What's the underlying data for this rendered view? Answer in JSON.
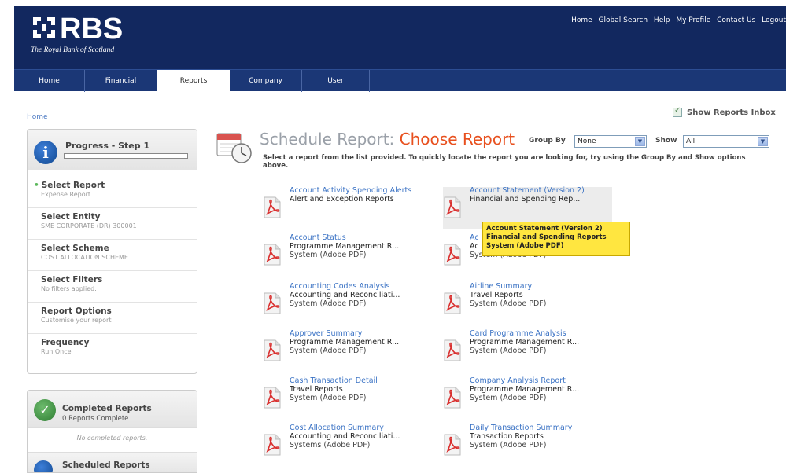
{
  "brand": {
    "name": "RBS",
    "tagline": "The Royal Bank of Scotland"
  },
  "toplinks": [
    "Home",
    "Global Search",
    "Help",
    "My Profile",
    "Contact Us",
    "Logout"
  ],
  "tabs": [
    "Home",
    "Financial",
    "Reports",
    "Company",
    "User"
  ],
  "active_tab": "Reports",
  "breadcrumb": "Home",
  "inbox": {
    "label": "Show Reports Inbox",
    "checked": true
  },
  "progress": {
    "title": "Progress - Step 1",
    "value": 0,
    "steps": [
      {
        "title": "Select Report",
        "sub": "Expense Report"
      },
      {
        "title": "Select Entity",
        "sub": "SME CORPORATE (DR) 300001"
      },
      {
        "title": "Select Scheme",
        "sub": "COST ALLOCATION SCHEME"
      },
      {
        "title": "Select Filters",
        "sub": "No filters applied."
      },
      {
        "title": "Report Options",
        "sub": "Customise your report"
      },
      {
        "title": "Frequency",
        "sub": "Run Once"
      }
    ]
  },
  "completed": {
    "title": "Completed Reports",
    "count": "0 Reports Complete",
    "empty": "No completed reports."
  },
  "scheduled": {
    "title": "Scheduled Reports"
  },
  "main": {
    "title_prefix": "Schedule Report: ",
    "title_accent": "Choose Report",
    "group_by_label": "Group By",
    "group_by_value": "None",
    "show_label": "Show",
    "show_value": "All",
    "instructions": "Select a report from the list provided. To quickly locate the report you are looking for, try using the Group By and Show options above."
  },
  "reports": [
    {
      "name": "Account Activity Spending Alerts",
      "category": "Alert and Exception Reports",
      "system": ""
    },
    {
      "name": "Account Statement (Version 2)",
      "category": "Financial and Spending Rep...",
      "system": ""
    },
    {
      "name": "Account Status",
      "category": "Programme Management R...",
      "system": "System (Adobe PDF)"
    },
    {
      "name": "Ac",
      "category": "Ac",
      "system": "System (Adobe PDF)"
    },
    {
      "name": "Accounting Codes Analysis",
      "category": "Accounting and Reconciliati...",
      "system": "System (Adobe PDF)"
    },
    {
      "name": "Airline Summary",
      "category": "Travel Reports",
      "system": "System (Adobe PDF)"
    },
    {
      "name": "Approver Summary",
      "category": "Programme Management R...",
      "system": "System (Adobe PDF)"
    },
    {
      "name": "Card Programme Analysis",
      "category": "Programme Management R...",
      "system": "System (Adobe PDF)"
    },
    {
      "name": "Cash Transaction Detail",
      "category": "Travel Reports",
      "system": "System (Adobe PDF)"
    },
    {
      "name": "Company Analysis Report",
      "category": "Programme Management R...",
      "system": "System (Adobe PDF)"
    },
    {
      "name": "Cost Allocation Summary",
      "category": "Accounting and Reconciliati...",
      "system": "Systems (Adobe PDF)"
    },
    {
      "name": "Daily Transaction Summary",
      "category": "Transaction Reports",
      "system": "System (Adobe PDF)"
    }
  ],
  "tooltip": {
    "line1": "Account Statement (Version 2)",
    "line2": "Financial and Spending Reports",
    "line3": "System (Adobe PDF)"
  },
  "colors": {
    "header_bg": "#12285f",
    "tab_bg": "#1b3776",
    "accent": "#e8501e",
    "link": "#3a72c4",
    "tooltip_bg": "#ffe640"
  }
}
